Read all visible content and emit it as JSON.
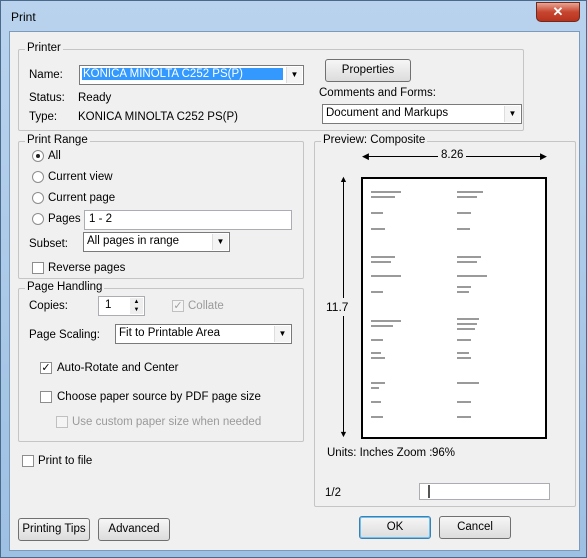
{
  "window": {
    "title": "Print",
    "close": "✕"
  },
  "printer": {
    "group_label": "Printer",
    "name_label": "Name:",
    "name_value": "KONICA MINOLTA C252 PS(P)",
    "status_label": "Status:",
    "status_value": "Ready",
    "type_label": "Type:",
    "type_value": "KONICA MINOLTA C252 PS(P)",
    "properties_button": "Properties",
    "comments_label": "Comments and Forms:",
    "comments_value": "Document and Markups"
  },
  "print_range": {
    "group_label": "Print Range",
    "all": "All",
    "current_view": "Current view",
    "current_page": "Current page",
    "pages": "Pages",
    "pages_value": "1 - 2",
    "subset_label": "Subset:",
    "subset_value": "All pages in range",
    "reverse_pages": "Reverse pages",
    "selected": "all"
  },
  "page_handling": {
    "group_label": "Page Handling",
    "copies_label": "Copies:",
    "copies_value": "1",
    "collate": "Collate",
    "scaling_label": "Page Scaling:",
    "scaling_value": "Fit to Printable Area",
    "auto_rotate": "Auto-Rotate and Center",
    "auto_rotate_checked": true,
    "paper_source": "Choose paper source by PDF page size",
    "custom_paper": "Use custom paper size when needed"
  },
  "print_to_file": "Print to file",
  "preview": {
    "group_label": "Preview: Composite",
    "width": "8.26",
    "height": "11.7",
    "units_zoom_label": "Units: Inches Zoom :",
    "zoom": "96%",
    "page_indicator": "1/2"
  },
  "buttons": {
    "printing_tips": "Printing Tips",
    "advanced": "Advanced",
    "ok": "OK",
    "cancel": "Cancel"
  }
}
